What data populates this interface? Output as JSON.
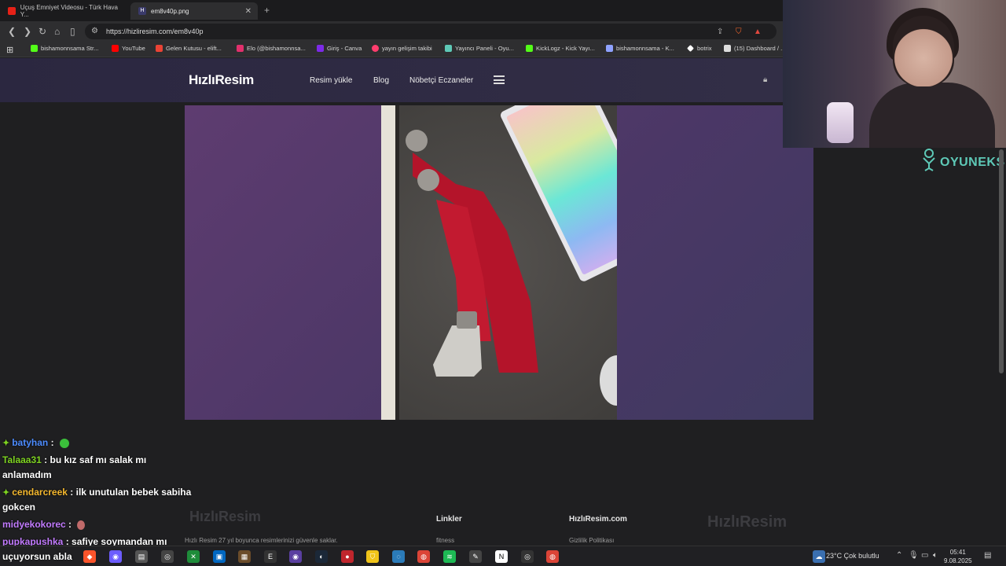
{
  "tabs": [
    {
      "title": "Uçuş Emniyet Videosu - Türk Hava Y...",
      "icon": "youtube-icon",
      "active": false
    },
    {
      "title": "em8v40p.png",
      "icon": "hizliresim-icon",
      "active": true
    }
  ],
  "address_bar": {
    "url": "https://hizliresim.com/em8v40p"
  },
  "bookmarks": [
    {
      "label": "bishamonnsama Str...",
      "icon": "kick-icon",
      "color": "#53fc18"
    },
    {
      "label": "YouTube",
      "icon": "youtube-icon",
      "color": "#ff0000"
    },
    {
      "label": "Gelen Kutusu - elift...",
      "icon": "gmail-icon",
      "color": "#ea4335"
    },
    {
      "label": "Elo (@bishamonnsa...",
      "icon": "instagram-icon",
      "color": "#e1306c"
    },
    {
      "label": "Giriş - Canva",
      "icon": "canva-icon",
      "color": "#7d2ae8"
    },
    {
      "label": "yayın gelişim takibi",
      "icon": "heart-icon",
      "color": "#ff3d6e"
    },
    {
      "label": "Yayıncı Paneli - Oyu...",
      "icon": "person-icon",
      "color": "#5ec9b7"
    },
    {
      "label": "KickLogz - Kick Yayı...",
      "icon": "kick-icon",
      "color": "#53fc18"
    },
    {
      "label": "bishamonnsama - K...",
      "icon": "link-icon",
      "color": "#8fa2ff"
    },
    {
      "label": "botrix",
      "icon": "botrix-icon",
      "color": "#ffffff"
    },
    {
      "label": "(15) Dashboard / ...",
      "icon": "dashboard-icon",
      "color": "#dddddd"
    }
  ],
  "site": {
    "logo": "HızlıResim",
    "nav": [
      "Resim yükle",
      "Blog",
      "Nöbetçi Eczaneler"
    ]
  },
  "chat": [
    {
      "user": "batyhan",
      "color": "#4d8cff",
      "sep": " :",
      "msg": "",
      "badge": true
    },
    {
      "user": "Talaaa31",
      "color": "#7ed321",
      "sep": " :",
      "msg": " bu kız saf mı salak mı",
      "badge": false
    },
    {
      "user": "",
      "color": "#ffffff",
      "sep": "",
      "msg": "anlamadım",
      "badge": false
    },
    {
      "user": "cendarcreek",
      "color": "#f5b82e",
      "sep": " :",
      "msg": " ilk unutulan bebek sabiha",
      "badge": true
    },
    {
      "user": "",
      "color": "#ffffff",
      "sep": "",
      "msg": "gokcen",
      "badge": false
    },
    {
      "user": "midyekokorec",
      "color": "#c27bff",
      "sep": " :",
      "msg": "",
      "badge": false
    },
    {
      "user": "pupkapushka",
      "color": "#c27bff",
      "sep": " :",
      "msg": " safiye soymandan mı",
      "badge": false
    }
  ],
  "chat_last": "uçuyorsun abla",
  "footer": {
    "logo_left": "HızlıResim",
    "logo_right": "HızlıResim",
    "col1_text": "Hızlı Resim 27 yıl boyunca resimlerinizi güvenle saklar.",
    "col2_head": "Linkler",
    "col2_sub": "fitness",
    "col3_head": "HızlıResim.com",
    "col3_sub": "Gizlilik Politikası"
  },
  "overlay_brand": "OYUNEKS",
  "taskbar": {
    "weather": "23°C  Çok bulutlu",
    "time": "05:41",
    "date": "9.08.2025"
  }
}
